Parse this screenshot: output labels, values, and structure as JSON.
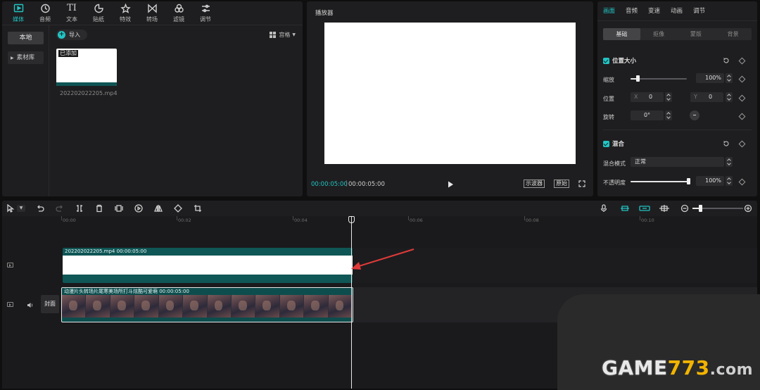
{
  "media": {
    "tabs": [
      {
        "label": "媒体",
        "icon": "media-icon"
      },
      {
        "label": "音频",
        "icon": "audio-icon"
      },
      {
        "label": "文本",
        "icon": "text-icon"
      },
      {
        "label": "贴纸",
        "icon": "sticker-icon"
      },
      {
        "label": "特效",
        "icon": "effects-icon"
      },
      {
        "label": "转场",
        "icon": "transition-icon"
      },
      {
        "label": "滤镜",
        "icon": "filter-icon"
      },
      {
        "label": "调节",
        "icon": "adjust-icon"
      }
    ],
    "text_glyph": "TI",
    "side_local": "本地",
    "side_library": "素材库",
    "import_label": "导入",
    "sort_label": "宫格",
    "clip_badge": "已添加",
    "clip_name": "202202022205.mp4"
  },
  "player": {
    "title": "播放器",
    "time_current": "00:00:05:00",
    "time_total": "00:00:05:00",
    "scope_label": "示波器",
    "original_label": "原始"
  },
  "props": {
    "tabs": [
      "画面",
      "音频",
      "变速",
      "动画",
      "调节"
    ],
    "sub_tabs": [
      "基础",
      "抠像",
      "蒙版",
      "背景"
    ],
    "position_size": {
      "title": "位置大小",
      "scale_label": "缩放",
      "scale_value": "100%",
      "scale_level": 0.12,
      "position_label": "位置",
      "x_label": "X",
      "x_value": "0",
      "y_label": "Y",
      "y_value": "0",
      "rotate_label": "旋转",
      "rotate_value": "0°"
    },
    "blend": {
      "title": "混合",
      "mode_label": "混合模式",
      "mode_value": "正常",
      "opacity_label": "不透明度",
      "opacity_value": "100%",
      "opacity_level": 1.0
    }
  },
  "timeline": {
    "ticks": [
      "00:00",
      "00:02",
      "00:04",
      "00:06",
      "00:08",
      "00:10"
    ],
    "clip_top_title": "202202022205.mp4    00:00:05:00",
    "clip_main_title": "动漫片头转场片尾寒美场所打斗炫酷可爱萌    00:00:05:00",
    "cover_label": "封面"
  },
  "watermark": {
    "game": "GAME",
    "num": "773",
    "dot_com": ".com"
  },
  "colors": {
    "accent": "#22c4c4",
    "clip_teal": "#0f5656",
    "arrow": "#e03a3a"
  }
}
